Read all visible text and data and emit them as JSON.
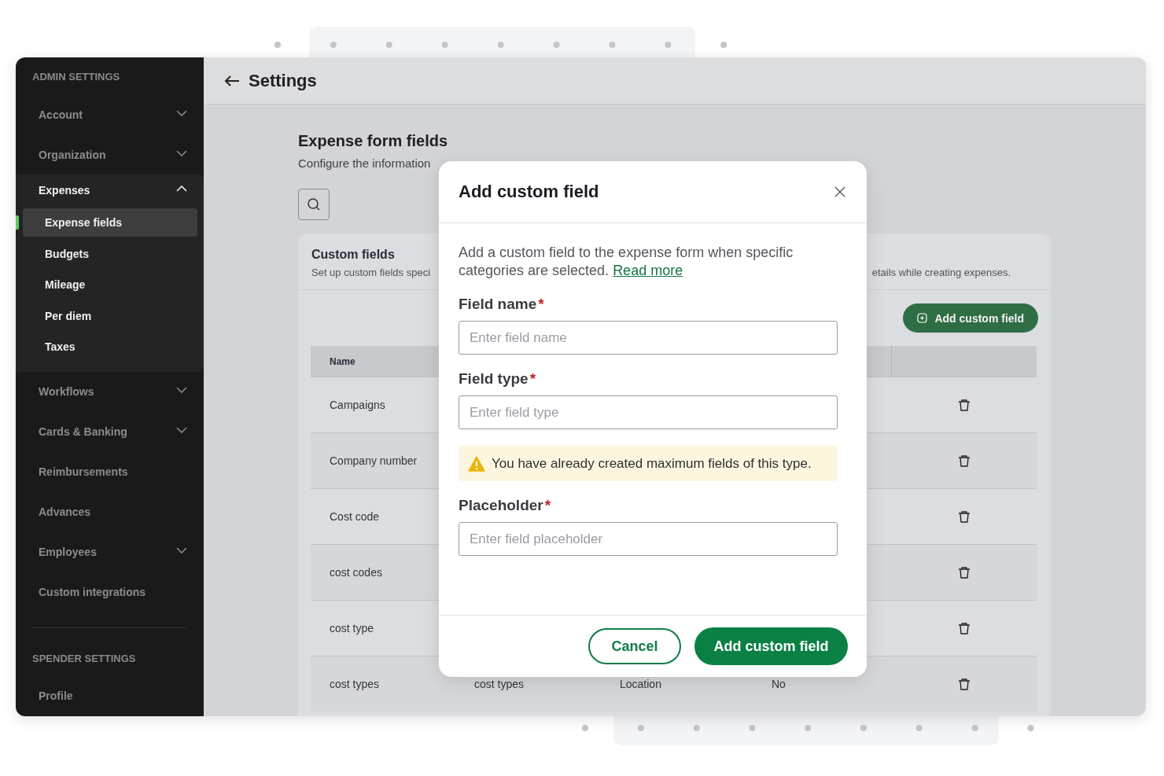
{
  "sidebar": {
    "sections": [
      {
        "title": "ADMIN SETTINGS",
        "items": [
          {
            "label": "Account",
            "kind": "menu",
            "expanded": false
          },
          {
            "label": "Organization",
            "kind": "menu",
            "expanded": false
          },
          {
            "label": "Expenses",
            "kind": "menu",
            "expanded": true,
            "children": [
              {
                "label": "Expense fields",
                "selected": true
              },
              {
                "label": "Budgets",
                "selected": false
              },
              {
                "label": "Mileage",
                "selected": false
              },
              {
                "label": "Per diem",
                "selected": false
              },
              {
                "label": "Taxes",
                "selected": false
              }
            ]
          },
          {
            "label": "Workflows",
            "kind": "menu",
            "expanded": false
          },
          {
            "label": "Cards & Banking",
            "kind": "menu",
            "expanded": false
          },
          {
            "label": "Reimbursements",
            "kind": "link"
          },
          {
            "label": "Advances",
            "kind": "link"
          },
          {
            "label": "Employees",
            "kind": "menu",
            "expanded": false
          },
          {
            "label": "Custom integrations",
            "kind": "link"
          }
        ]
      },
      {
        "title": "SPENDER SETTINGS",
        "items": [
          {
            "label": "Profile",
            "kind": "link"
          }
        ]
      }
    ]
  },
  "header": {
    "title": "Settings"
  },
  "page": {
    "title": "Expense form fields",
    "subtitle": "Configure the information"
  },
  "card": {
    "title": "Custom fields",
    "description_left": "Set up custom fields speci",
    "description_right": "etails while creating expenses.",
    "add_button": "Add custom field",
    "table": {
      "columns": [
        "Name"
      ],
      "rows": [
        {
          "cells": [
            "Campaigns"
          ]
        },
        {
          "cells": [
            "Company number"
          ]
        },
        {
          "cells": [
            "Cost code"
          ]
        },
        {
          "cells": [
            "cost codes"
          ]
        },
        {
          "cells": [
            "cost type"
          ]
        },
        {
          "cells": [
            "cost types",
            "cost types",
            "Location",
            "No"
          ]
        }
      ]
    }
  },
  "dialog": {
    "title": "Add custom field",
    "description": "Add a custom field to the expense form when specific categories are selected.",
    "link": "Read more",
    "fields": [
      {
        "label": "Field name",
        "required_mark": "*",
        "placeholder": "Enter field name"
      },
      {
        "label": "Field type",
        "required_mark": "*",
        "placeholder": "Enter field type",
        "warning": "You have already created maximum fields of this type."
      },
      {
        "label": "Placeholder",
        "required_mark": "*",
        "placeholder": "Enter field placeholder"
      }
    ],
    "buttons": [
      {
        "label": "Cancel",
        "kind": "secondary"
      },
      {
        "label": "Add custom field",
        "kind": "primary"
      }
    ]
  }
}
